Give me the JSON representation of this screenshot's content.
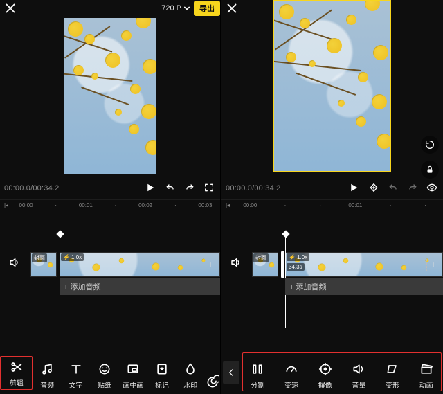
{
  "left": {
    "resolution": "720 P",
    "export": "导出",
    "time": "00:00.0/00:34.2",
    "ruler": [
      "00:00",
      "00:01",
      "00:02",
      "00:03"
    ],
    "cover": "封面",
    "speed": "1.0x",
    "addAudio": "+ 添加音频",
    "tools": [
      {
        "k": "cut",
        "label": "剪辑"
      },
      {
        "k": "audio",
        "label": "音频"
      },
      {
        "k": "text",
        "label": "文字"
      },
      {
        "k": "sticker",
        "label": "贴纸"
      },
      {
        "k": "pip",
        "label": "画中画"
      },
      {
        "k": "mark",
        "label": "标记"
      },
      {
        "k": "water",
        "label": "水印"
      }
    ]
  },
  "right": {
    "time": "00:00.0/00:34.2",
    "ruler": [
      "00:00",
      "00:01"
    ],
    "cover": "封面",
    "speed": "1.0x",
    "duration": "34.3s",
    "addAudio": "+ 添加音频",
    "tools": [
      {
        "k": "split",
        "label": "分割"
      },
      {
        "k": "tempo",
        "label": "变速"
      },
      {
        "k": "trim",
        "label": "摒像"
      },
      {
        "k": "vol",
        "label": "音量"
      },
      {
        "k": "warp",
        "label": "变形"
      },
      {
        "k": "anim",
        "label": "动画"
      }
    ]
  }
}
